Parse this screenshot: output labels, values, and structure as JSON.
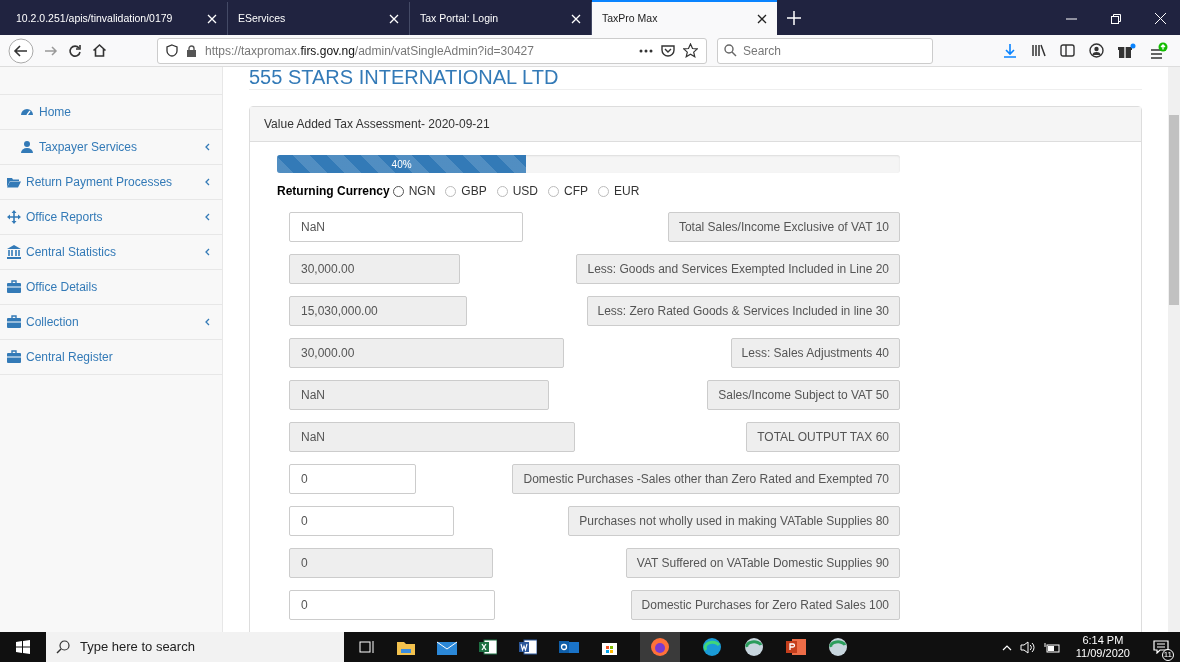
{
  "browser": {
    "tabs": [
      {
        "title": "10.2.0.251/apis/tinvalidation/0179",
        "selected": false
      },
      {
        "title": "EServices",
        "selected": false
      },
      {
        "title": "Tax Portal: Login",
        "selected": false
      },
      {
        "title": "TaxPro Max",
        "selected": true
      }
    ],
    "url_host_prefix": "https://taxpromax.",
    "url_host": "firs.gov.ng",
    "url_path": "/admin/vatSingleAdmin?id=30427",
    "search_placeholder": "Search"
  },
  "sidebar": {
    "items": [
      {
        "label": "Home",
        "kind": "dashboard",
        "expandable": false
      },
      {
        "label": "Taxpayer Services",
        "kind": "user",
        "expandable": true
      },
      {
        "label": "Return Payment Processes",
        "kind": "folder",
        "expandable": true
      },
      {
        "label": "Office Reports",
        "kind": "move",
        "expandable": true
      },
      {
        "label": "Central Statistics",
        "kind": "bank",
        "expandable": true
      },
      {
        "label": "Office Details",
        "kind": "briefcase",
        "expandable": false
      },
      {
        "label": "Collection",
        "kind": "briefcase",
        "expandable": true
      },
      {
        "label": "Central Register",
        "kind": "briefcase",
        "expandable": false
      }
    ]
  },
  "company": "555 STARS INTERNATIONAL LTD",
  "panel": {
    "title": "Value Added Tax Assessment- 2020-09-21",
    "progress": {
      "level": 0.4,
      "label": "40%"
    },
    "currency_label": "Returning Currency",
    "currencies": [
      {
        "label": "NGN",
        "selected": false
      },
      {
        "label": "GBP",
        "selected": false
      },
      {
        "label": "USD",
        "selected": false
      },
      {
        "label": "CFP",
        "selected": false
      },
      {
        "label": "EUR",
        "selected": false
      }
    ],
    "fields": [
      {
        "value": "NaN",
        "disabled": false,
        "label": "Total Sales/Income Exclusive of VAT 10"
      },
      {
        "value": "30,000.00",
        "disabled": true,
        "label": "Less: Goods and Services Exempted Included in Line 20"
      },
      {
        "value": "15,030,000.00",
        "disabled": true,
        "label": "Less: Zero Rated Goods & Services Included in line 30"
      },
      {
        "value": "30,000.00",
        "disabled": true,
        "label": "Less: Sales Adjustments 40"
      },
      {
        "value": "NaN",
        "disabled": true,
        "label": "Sales/Income Subject to VAT 50"
      },
      {
        "value": "NaN",
        "disabled": true,
        "label": "TOTAL OUTPUT TAX 60"
      },
      {
        "value": "0",
        "disabled": false,
        "label": "Domestic Purchases -Sales other than Zero Rated and Exempted 70"
      },
      {
        "value": "0",
        "disabled": false,
        "label": "Purchases not wholly used in making VATable Supplies 80"
      },
      {
        "value": "0",
        "disabled": true,
        "label": "VAT Suffered on VATable Domestic Supplies 90"
      },
      {
        "value": "0",
        "disabled": false,
        "label": "Domestic Purchases for Zero Rated Sales 100"
      }
    ]
  },
  "taskbar": {
    "search_placeholder": "Type here to search",
    "time": "6:14 PM",
    "date": "11/09/2020",
    "notifications": "11"
  }
}
